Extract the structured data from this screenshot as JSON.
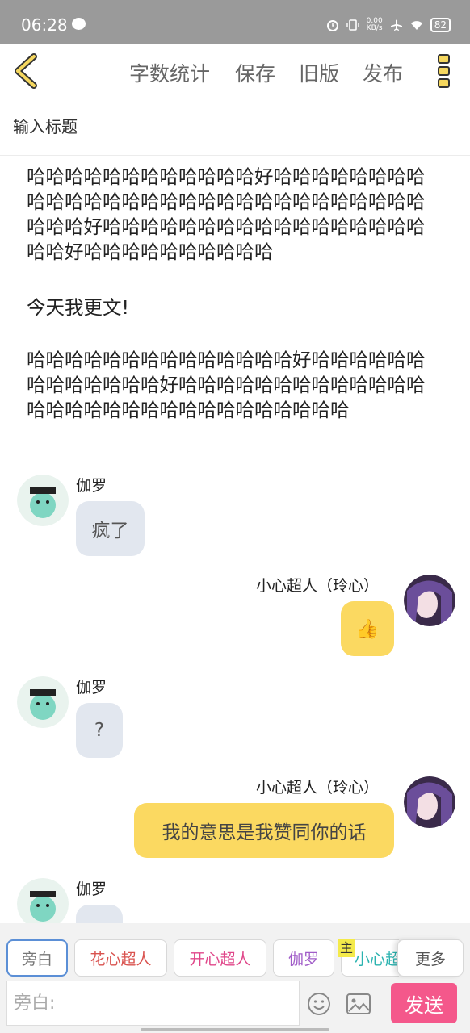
{
  "status_bar": {
    "time": "06:28",
    "net_speed_value": "0.00",
    "net_speed_unit": "KB/s",
    "battery": "82",
    "icons": [
      "message-icon",
      "alarm-icon",
      "vibrate-icon",
      "airplane-icon",
      "wifi-icon",
      "battery-icon"
    ]
  },
  "toolbar": {
    "word_count": "字数统计",
    "save": "保存",
    "old_version": "旧版",
    "publish": "发布"
  },
  "title_field": {
    "placeholder": "输入标题"
  },
  "content": {
    "paragraphs": [
      "哈哈哈哈哈哈哈哈哈哈哈哈好哈哈哈哈哈哈哈哈哈哈哈哈哈哈哈哈哈哈哈哈哈哈哈哈哈哈哈哈哈哈哈哈好哈哈哈哈哈哈哈哈哈哈哈哈哈哈哈哈哈哈哈好哈哈哈哈哈哈哈哈哈哈",
      "今天我更文!",
      "哈哈哈哈哈哈哈哈哈哈哈哈哈哈好哈哈哈哈哈哈哈哈哈哈哈哈哈好哈哈哈哈哈哈哈哈哈哈哈哈哈哈哈哈哈哈哈哈哈哈哈哈哈哈哈哈哈哈"
    ],
    "messages": [
      {
        "side": "left",
        "sender": "伽罗",
        "text": "疯了",
        "bubble": "grey"
      },
      {
        "side": "right",
        "sender": "小心超人（玲心）",
        "text": "👍",
        "bubble": "yellow"
      },
      {
        "side": "left",
        "sender": "伽罗",
        "text": "?",
        "bubble": "grey"
      },
      {
        "side": "right",
        "sender": "小心超人（玲心）",
        "text": "我的意思是我赞同你的话",
        "bubble": "yellow"
      },
      {
        "side": "left",
        "sender": "伽罗",
        "text": "",
        "bubble": "grey"
      }
    ]
  },
  "role_bar": {
    "roles": [
      {
        "label": "旁白",
        "color": "#777777"
      },
      {
        "label": "花心超人",
        "color": "#d9534f"
      },
      {
        "label": "开心超人",
        "color": "#e0478a"
      },
      {
        "label": "伽罗",
        "color": "#a05cc8"
      },
      {
        "label": "小心超",
        "color": "#2bb3b0"
      }
    ],
    "host_badge": "主",
    "more": "更多"
  },
  "composer": {
    "placeholder": "旁白:",
    "send": "发送"
  },
  "colors": {
    "accent_yellow": "#fbd961",
    "send_pink": "#f4588b",
    "bubble_grey": "#e2e7ef",
    "status_bar": "#9a9a9a"
  }
}
